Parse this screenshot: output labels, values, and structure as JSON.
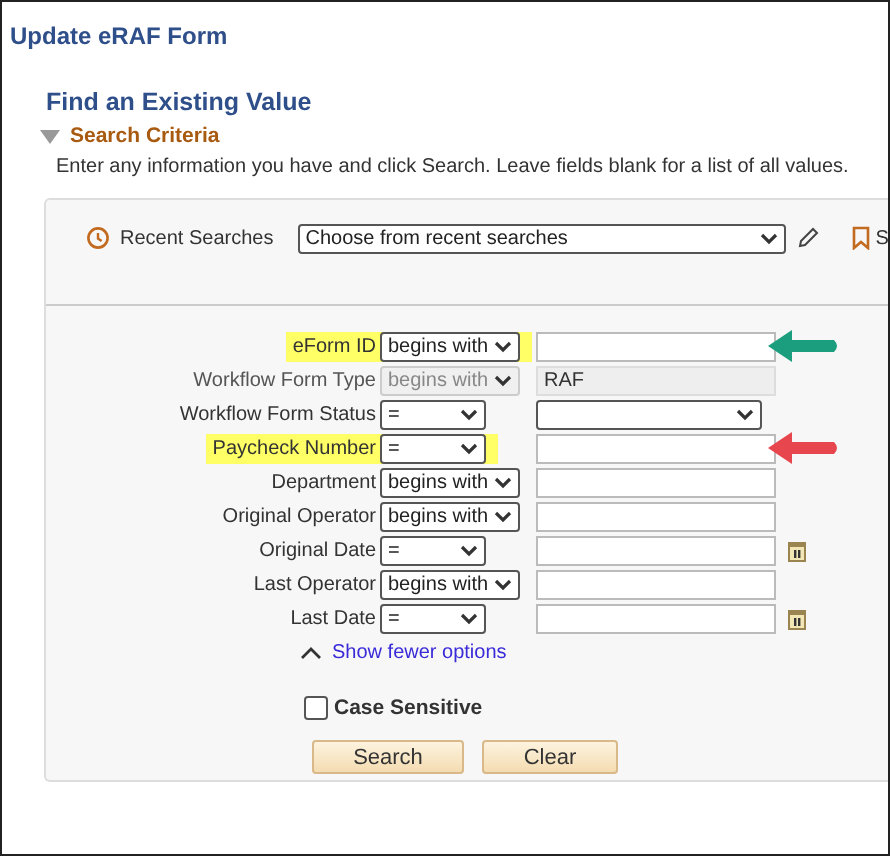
{
  "page_title": "Update eRAF Form",
  "heading": "Find an Existing Value",
  "section": {
    "title": "Search Criteria",
    "expanded": true
  },
  "instructions": "Enter any information you have and click Search. Leave fields blank for a list of all values.",
  "recent_searches": {
    "label": "Recent Searches",
    "value": "Choose from recent searches",
    "save_label": "S"
  },
  "fields": [
    {
      "label": "eForm ID",
      "operator": "begins with",
      "kind": "text",
      "highlighted": true,
      "arrow": {
        "color": "#1a9e7e"
      }
    },
    {
      "label": "Workflow Form Type",
      "operator": "begins with",
      "kind": "text",
      "value": "RAF",
      "disabled": true
    },
    {
      "label": "Workflow Form Status",
      "operator": "=",
      "kind": "list"
    },
    {
      "label": "Paycheck Number",
      "operator": "=",
      "kind": "text",
      "highlighted": true,
      "arrow": {
        "color": "#e8464f"
      }
    },
    {
      "label": "Department",
      "operator": "begins with",
      "kind": "text"
    },
    {
      "label": "Original Operator",
      "operator": "begins with",
      "kind": "text"
    },
    {
      "label": "Original Date",
      "operator": "=",
      "kind": "date"
    },
    {
      "label": "Last Operator",
      "operator": "begins with",
      "kind": "text"
    },
    {
      "label": "Last Date",
      "operator": "=",
      "kind": "date"
    }
  ],
  "toggle_link": "Show fewer options",
  "case_sensitive": {
    "label": "Case Sensitive",
    "checked": false
  },
  "buttons": [
    "Search",
    "Clear"
  ]
}
